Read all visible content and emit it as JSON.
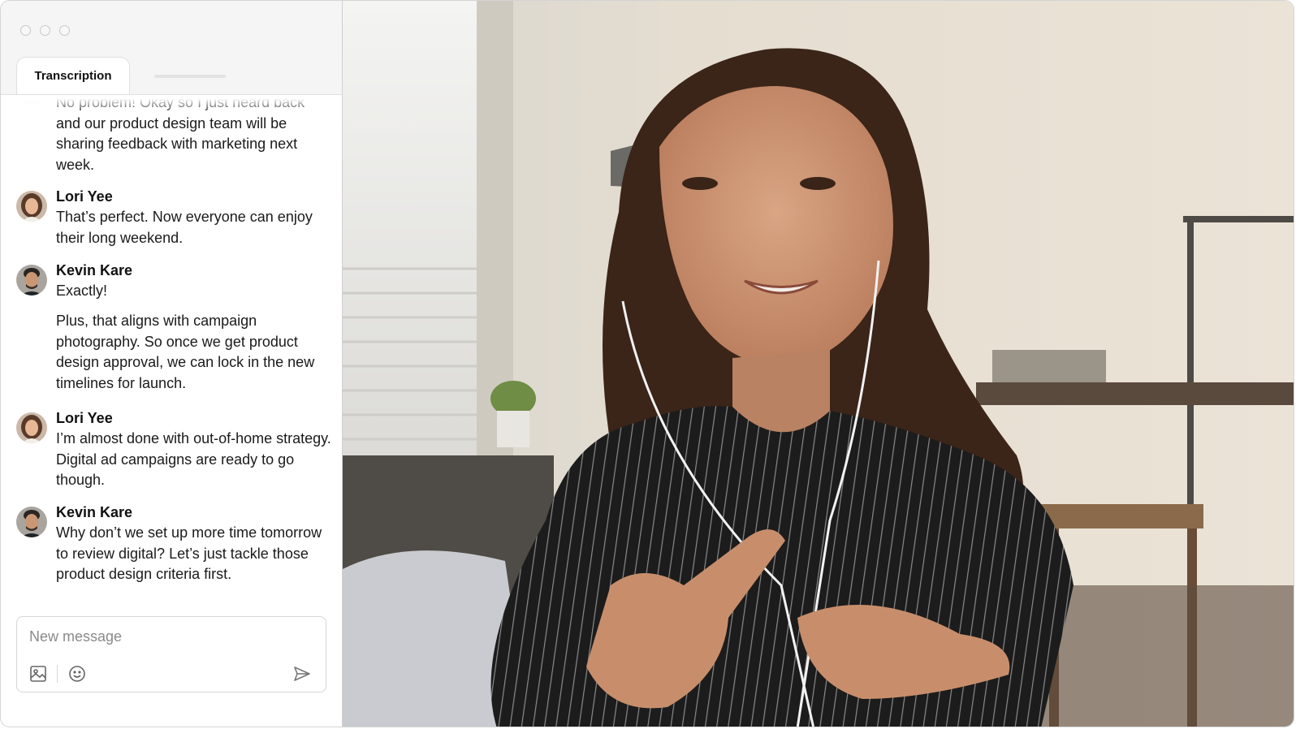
{
  "window": {
    "controls": [
      "close-button",
      "minimize-button",
      "zoom-button"
    ]
  },
  "sidebar": {
    "tabs": [
      {
        "label": "Transcription",
        "active": true
      },
      {
        "label": "",
        "active": false
      }
    ],
    "messages": [
      {
        "speaker": "",
        "avatar": "",
        "paragraphs": [
          "No problem! Okay so I just heard back and our product design team will be sharing feedback with marketing next week."
        ]
      },
      {
        "speaker": "Lori Yee",
        "avatar": "woman-avatar",
        "paragraphs": [
          "That’s perfect. Now everyone can enjoy their long weekend."
        ]
      },
      {
        "speaker": "Kevin Kare",
        "avatar": "man-avatar",
        "paragraphs": [
          "Exactly!",
          "Plus, that aligns with campaign photography. So once we get product design approval, we can lock in the new timelines for launch."
        ]
      },
      {
        "speaker": "Lori Yee",
        "avatar": "woman-avatar",
        "paragraphs": [
          "I’m almost done with out-of-home strategy. Digital ad campaigns are ready to go though."
        ]
      },
      {
        "speaker": "Kevin Kare",
        "avatar": "man-avatar",
        "paragraphs": [
          "Why don’t we set up more time tomorrow to review digital? Let’s just tackle those product design criteria first."
        ]
      }
    ],
    "composer": {
      "placeholder": "New message",
      "value": "",
      "icons": [
        "image-icon",
        "emoji-icon",
        "send-icon"
      ]
    }
  },
  "video": {
    "subject": "woman-with-earphones-speaking"
  },
  "colors": {
    "titlebar": "#f5f5f5",
    "border": "#d4d4d4",
    "text": "#1a1a1a"
  }
}
